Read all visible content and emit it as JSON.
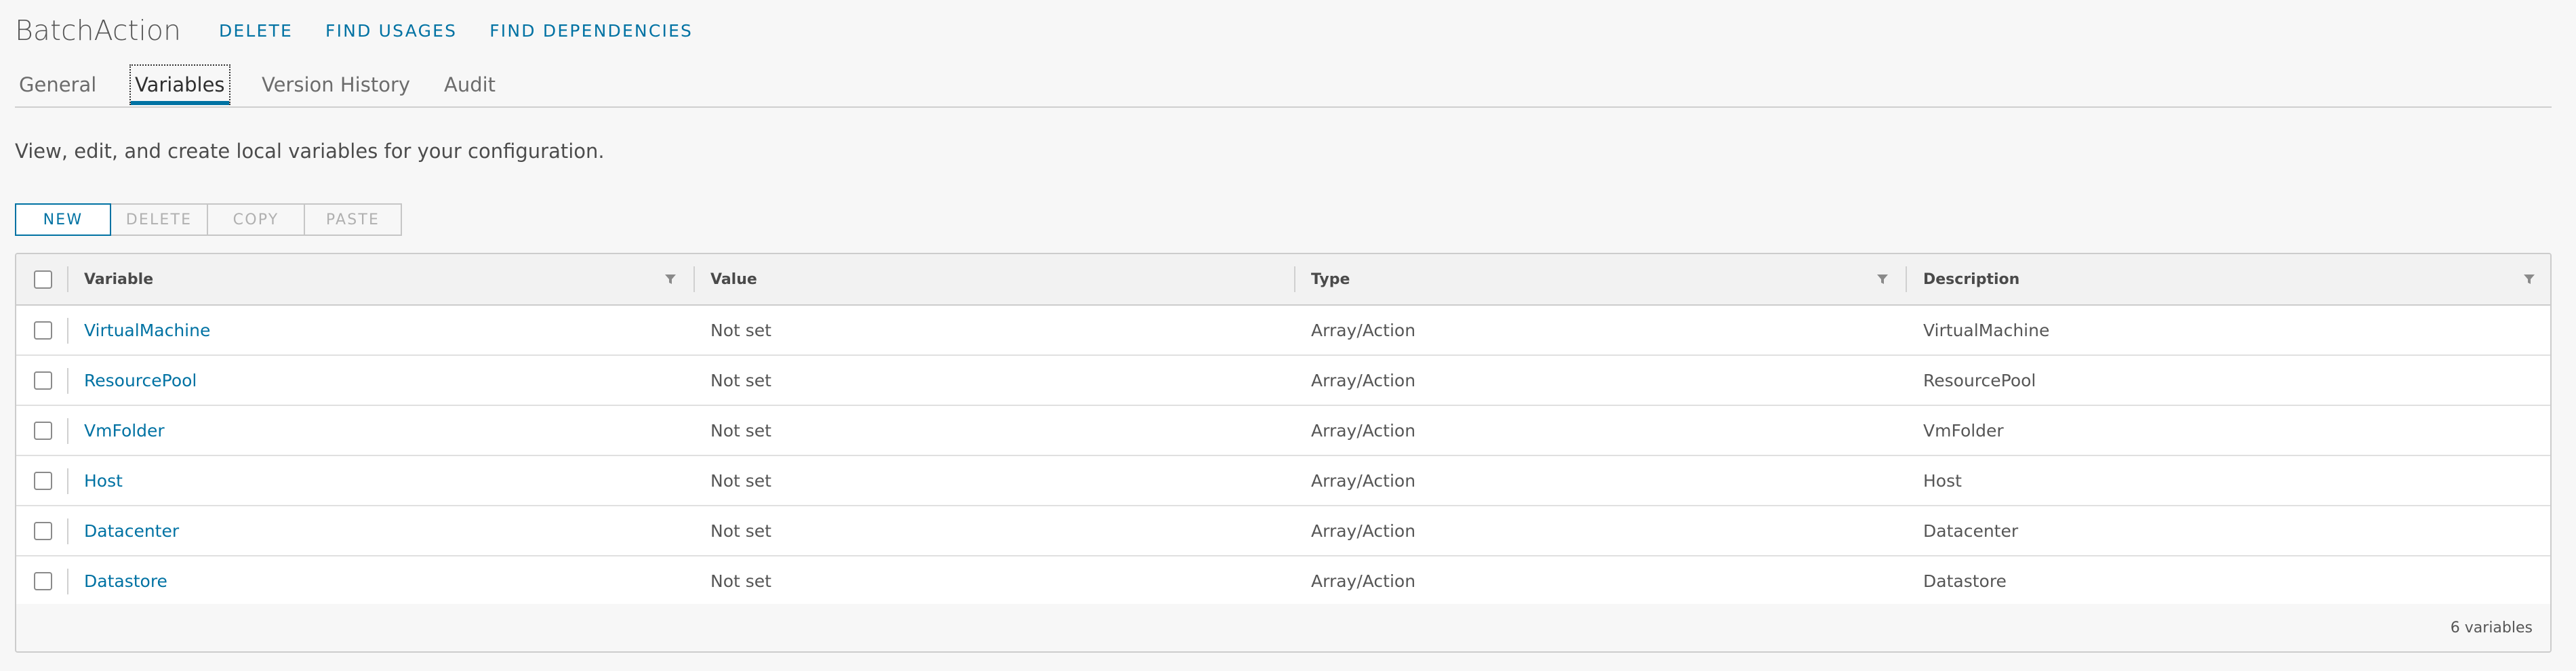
{
  "header": {
    "title": "BatchAction",
    "actions": [
      "DELETE",
      "FIND USAGES",
      "FIND DEPENDENCIES"
    ]
  },
  "tabs": [
    {
      "label": "General",
      "active": false
    },
    {
      "label": "Variables",
      "active": true
    },
    {
      "label": "Version History",
      "active": false
    },
    {
      "label": "Audit",
      "active": false
    }
  ],
  "intro": "View, edit, and create local variables for your configuration.",
  "toolbar": {
    "new": "NEW",
    "delete": "DELETE",
    "copy": "COPY",
    "paste": "PASTE"
  },
  "grid": {
    "columns": {
      "variable": "Variable",
      "value": "Value",
      "type": "Type",
      "description": "Description"
    },
    "rows": [
      {
        "name": "VirtualMachine",
        "value": "Not set",
        "type": "Array/Action",
        "description": "VirtualMachine"
      },
      {
        "name": "ResourcePool",
        "value": "Not set",
        "type": "Array/Action",
        "description": "ResourcePool"
      },
      {
        "name": "VmFolder",
        "value": "Not set",
        "type": "Array/Action",
        "description": "VmFolder"
      },
      {
        "name": "Host",
        "value": "Not set",
        "type": "Array/Action",
        "description": "Host"
      },
      {
        "name": "Datacenter",
        "value": "Not set",
        "type": "Array/Action",
        "description": "Datacenter"
      },
      {
        "name": "Datastore",
        "value": "Not set",
        "type": "Array/Action",
        "description": "Datastore"
      }
    ],
    "footer": "6 variables"
  },
  "colors": {
    "accent": "#0072a3",
    "text": "#565656",
    "border": "#cccccc"
  }
}
